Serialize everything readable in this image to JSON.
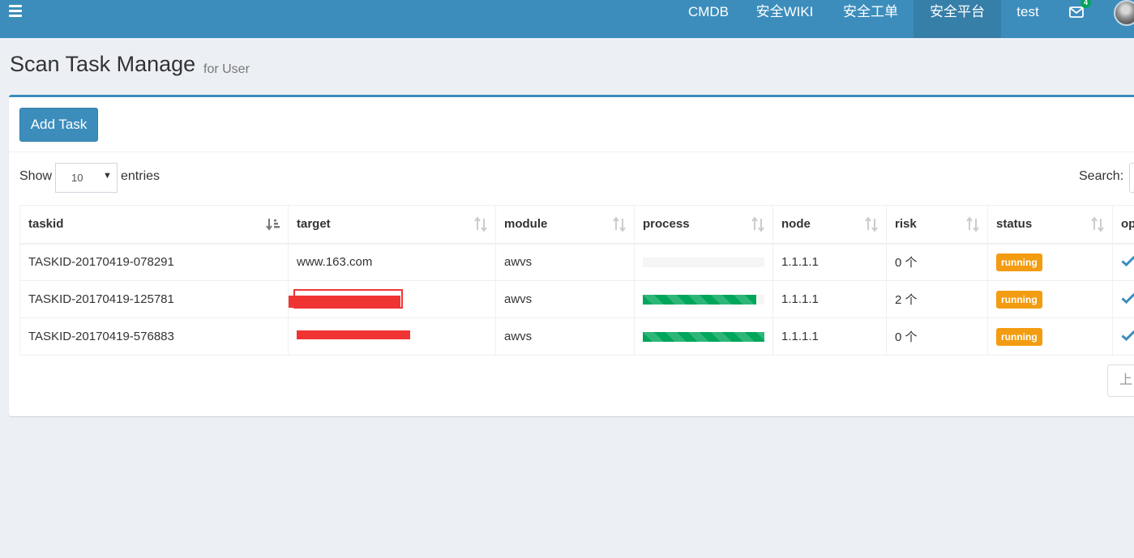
{
  "navbar": {
    "menu_icon": "hamburger-icon",
    "items": [
      {
        "label": "CMDB",
        "active": false
      },
      {
        "label": "安全WIKI",
        "active": false
      },
      {
        "label": "安全工单",
        "active": false
      },
      {
        "label": "安全平台",
        "active": true
      },
      {
        "label": "test",
        "active": false
      }
    ],
    "mail_icon": "envelope-icon",
    "mail_count": "4",
    "avatar_icon": "user-avatar"
  },
  "page": {
    "title": "Scan Task Manage",
    "subtitle": "for User"
  },
  "toolbar": {
    "add_label": "Add Task"
  },
  "datatable": {
    "show_label": "Show",
    "length_value": "10",
    "entries_label": "entries",
    "search_label": "Search:",
    "columns": [
      {
        "label": "taskid",
        "sort": "sort-asc-icon"
      },
      {
        "label": "target",
        "sort": "sort-both-icon"
      },
      {
        "label": "module",
        "sort": "sort-both-icon"
      },
      {
        "label": "process",
        "sort": "sort-both-icon"
      },
      {
        "label": "node",
        "sort": "sort-both-icon"
      },
      {
        "label": "risk",
        "sort": "sort-both-icon"
      },
      {
        "label": "status",
        "sort": "sort-both-icon"
      },
      {
        "label": "op",
        "sort": ""
      }
    ],
    "rows": [
      {
        "taskid": "TASKID-20170419-078291",
        "target": "www.163.com",
        "target_redacted": false,
        "module": "awvs",
        "progress": 0,
        "node": "1.1.1.1",
        "risk": "0 个",
        "status": "running",
        "op_icon": "check-icon"
      },
      {
        "taskid": "TASKID-20170419-125781",
        "target": "",
        "target_redacted": true,
        "module": "awvs",
        "progress": 0.93,
        "node": "1.1.1.1",
        "risk": "2 个",
        "status": "running",
        "op_icon": "check-icon"
      },
      {
        "taskid": "TASKID-20170419-576883",
        "target": "",
        "target_redacted": true,
        "module": "awvs",
        "progress": 1.0,
        "node": "1.1.1.1",
        "risk": "0 个",
        "status": "running",
        "op_icon": "check-icon"
      }
    ],
    "pagination_prev": "上",
    "colors": {
      "primary": "#3c8dbc",
      "progress": "#00a65a",
      "status_running": "#f39c12",
      "redaction": "#f03434"
    }
  }
}
